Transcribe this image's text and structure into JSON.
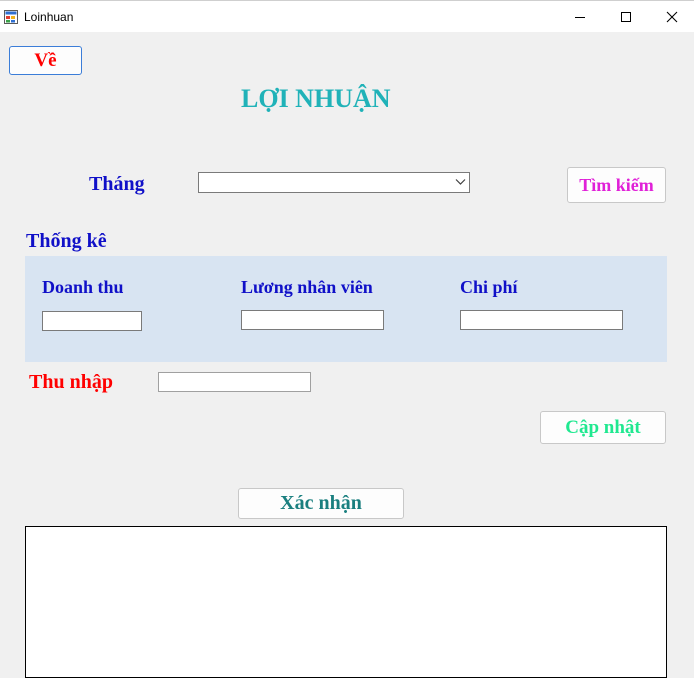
{
  "window": {
    "title": "Loinhuan",
    "icon": "app-form-icon",
    "controls": [
      "minimize-icon",
      "maximize-icon",
      "close-icon"
    ]
  },
  "form": {
    "back_button": "Về",
    "title": "LỢI NHUẬN",
    "month_label": "Tháng",
    "month_value": "",
    "search_button": "Tìm kiếm",
    "stats_label": "Thống kê",
    "stats": {
      "revenue_label": "Doanh thu",
      "revenue_value": "",
      "salary_label": "Lương nhân viên",
      "salary_value": "",
      "cost_label": "Chi phí",
      "cost_value": ""
    },
    "income_label": "Thu nhập",
    "income_value": "",
    "update_button": "Cập nhật",
    "confirm_button": "Xác nhận",
    "result_text": ""
  },
  "colors": {
    "title": "#20b2b8",
    "label_blue": "#1010c8",
    "back_text": "#ff0000",
    "search_text": "#e020d8",
    "update_text": "#20e890",
    "confirm_text": "#1a7f7f",
    "income_label": "#ff0000",
    "stats_panel": "#d8e4f2",
    "form_background": "#f0f0f0"
  }
}
